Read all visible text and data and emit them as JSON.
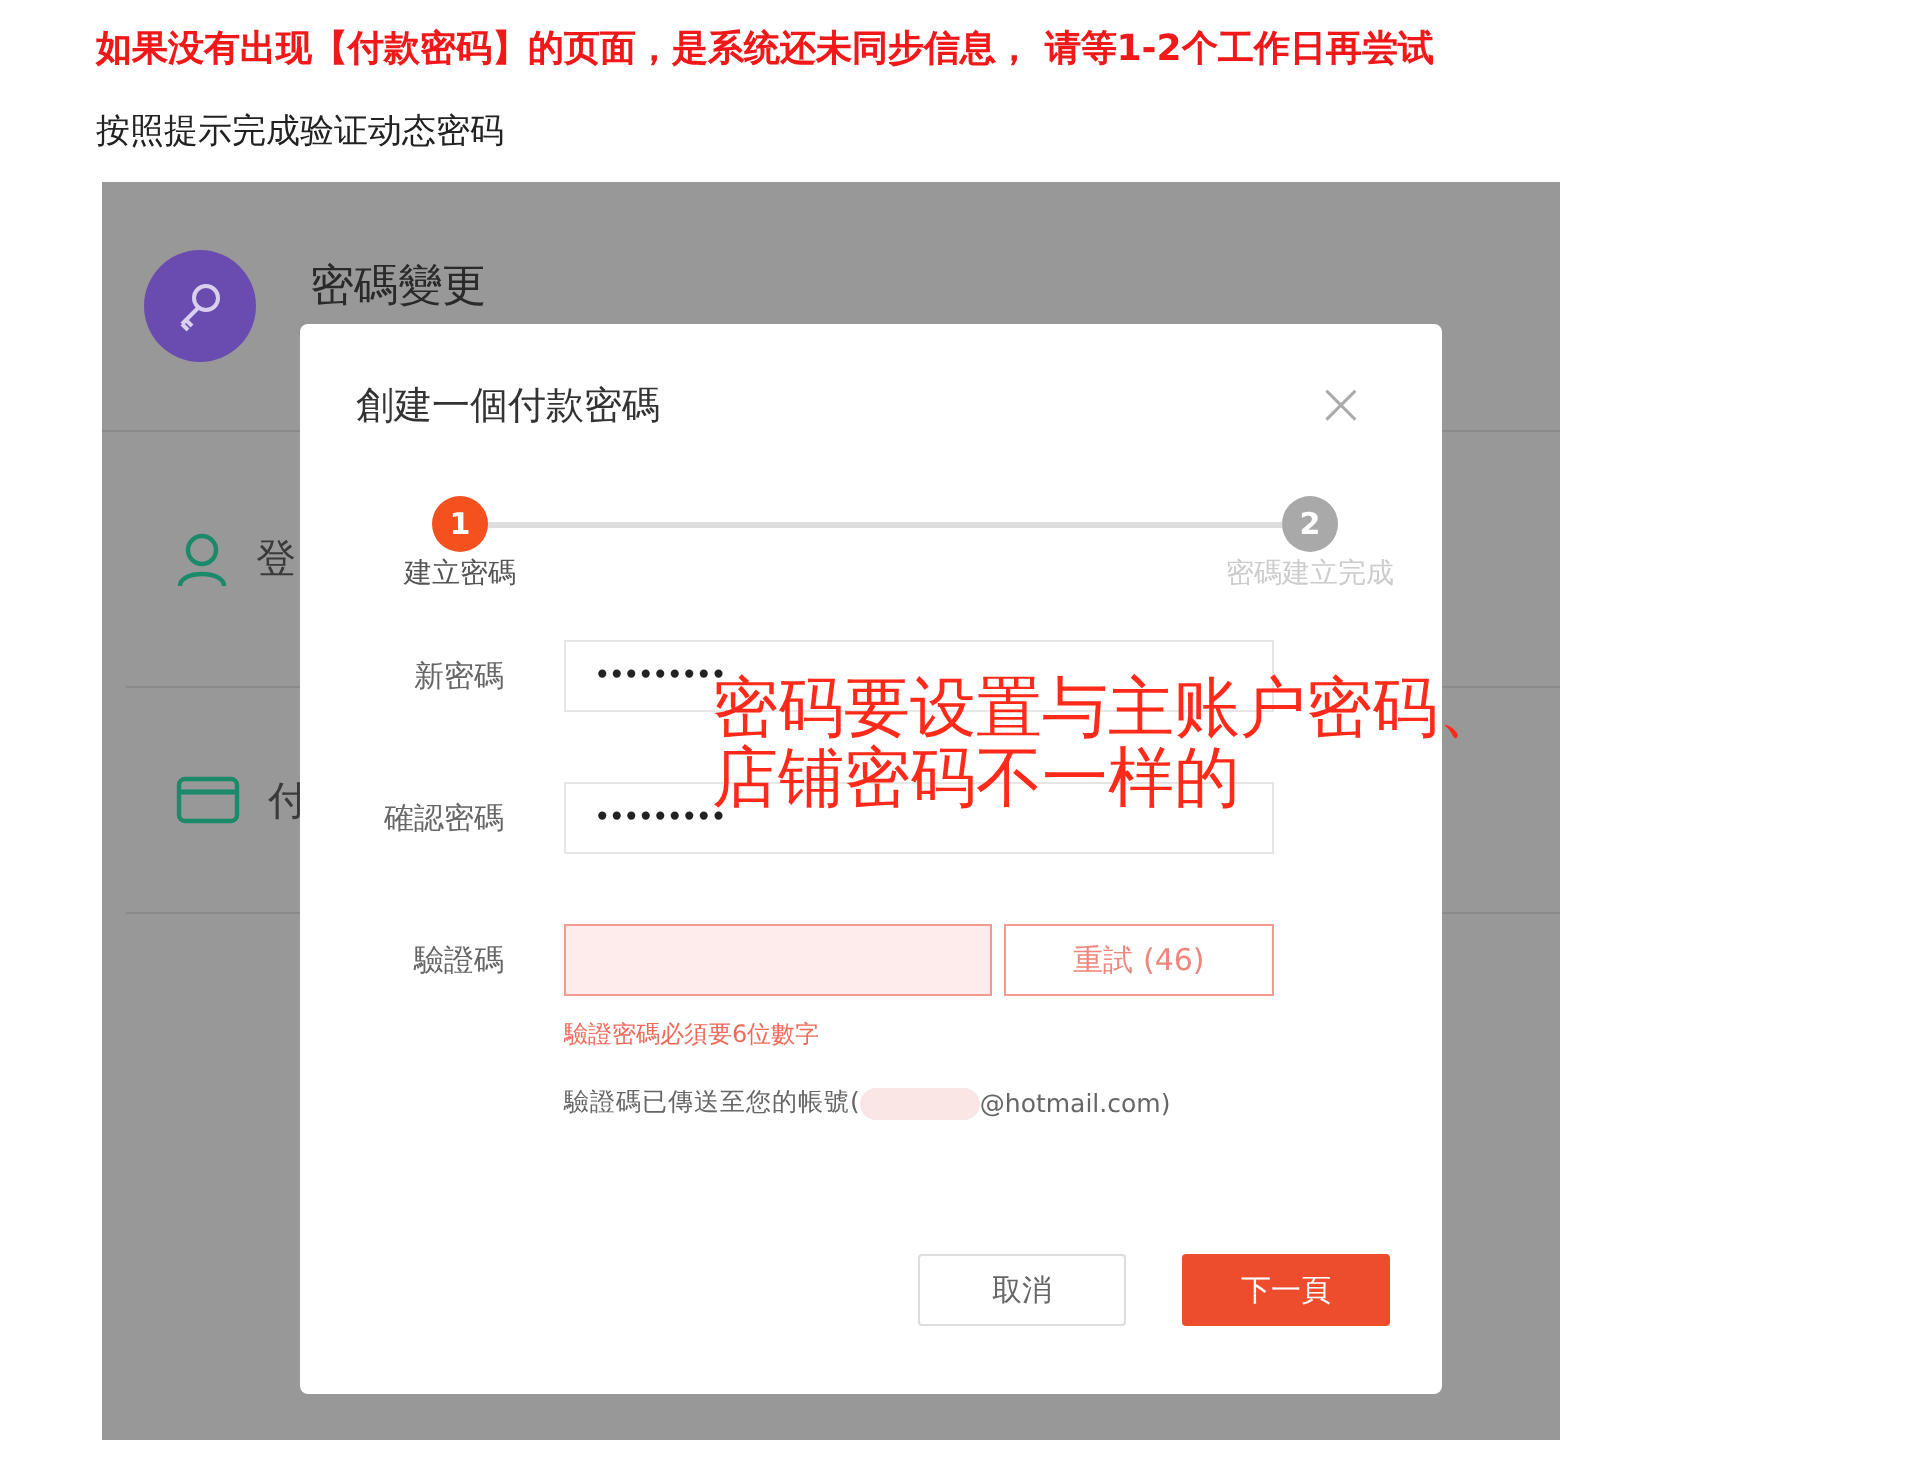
{
  "notice": "如果没有出现【付款密码】的页面，是系统还未同步信息， 请等1-2个工作日再尝试",
  "instruction": "按照提示完成验证动态密码",
  "screenshot": {
    "page_title": "密碼變更",
    "menu_items": [
      {
        "kind": "person",
        "label": "登"
      },
      {
        "kind": "card",
        "label": "付"
      }
    ],
    "dialog": {
      "title": "創建一個付款密碼",
      "close": "×",
      "steps": [
        {
          "number": "1",
          "label": "建立密碼",
          "active": true
        },
        {
          "number": "2",
          "label": "密碼建立完成",
          "active": false
        }
      ],
      "fields": [
        {
          "label": "新密碼",
          "value": "•••••••••",
          "error": false
        },
        {
          "label": "確認密碼",
          "value": "•••••••••",
          "error": false
        },
        {
          "label": "驗證碼",
          "error": true,
          "action": "重試 (46)"
        }
      ],
      "error_message": "驗證密碼必須要6位數字",
      "sent_prefix": "驗證碼已傳送至您的帳號(",
      "sent_suffix": "@hotmail.com)",
      "buttons": [
        {
          "label": "取消",
          "primary": false
        },
        {
          "label": "下一頁",
          "primary": true
        }
      ]
    },
    "annotation_lines": [
      "密码要设置与主账户密码、",
      "店铺密码不一样的"
    ]
  }
}
